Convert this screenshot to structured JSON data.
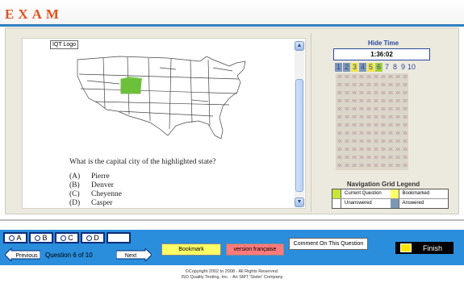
{
  "header": {
    "logo": "EXAM"
  },
  "question_panel": {
    "logo_placeholder": "IQT Logo",
    "question": "What is the capital city of the highlighted state?",
    "answers": [
      {
        "key": "(A)",
        "text": "Pierre"
      },
      {
        "key": "(B)",
        "text": "Denver"
      },
      {
        "key": "(C)",
        "text": "Cheyenne"
      },
      {
        "key": "(D)",
        "text": "Casper"
      }
    ],
    "scroll_up_icon": "chevron-up-icon",
    "scroll_down_icon": "chevron-down-icon"
  },
  "timer": {
    "hide_label": "Hide Time",
    "time": "1:36:02"
  },
  "nav_grid": {
    "question_numbers": [
      "1",
      "2",
      "3",
      "4",
      "5",
      "6",
      "7",
      "8",
      "9",
      "10"
    ],
    "cell_text": "xx",
    "rows": 12,
    "number_colors": {
      "1": "#7f97b6",
      "2": "#7f97b6",
      "3": "#f1e34a",
      "4": "#7f97b6",
      "5": "#f1e34a",
      "6": "#a6d13a"
    }
  },
  "legend": {
    "title": "Navigation Grid Legend",
    "items": [
      {
        "label": "Current Question",
        "color": "#c8e63a"
      },
      {
        "label": "Bookmarked",
        "color": "#ffff66"
      },
      {
        "label": "Unanswered",
        "color": "#ffffff"
      },
      {
        "label": "Answered",
        "color": "#7f97b6"
      }
    ]
  },
  "options": {
    "labels": [
      "A",
      "B",
      "C",
      "D"
    ]
  },
  "navigation": {
    "previous": "Previous",
    "next": "Next",
    "question_counter": "Question 6 of 10"
  },
  "actions": {
    "bookmark": "Bookmark",
    "french": "version française",
    "comment": "Comment On This Question",
    "finish": "Finish"
  },
  "footer": {
    "line1": "©Copyright 2002 to 2008 - All Rights Reserved.",
    "line2": "ISO Quality Testing, Inc. - An SMT 'Sister' Company"
  },
  "colors": {
    "accent": "#2a8edc",
    "highlight_state": "#6dc13b",
    "brand": "#e0521f"
  }
}
